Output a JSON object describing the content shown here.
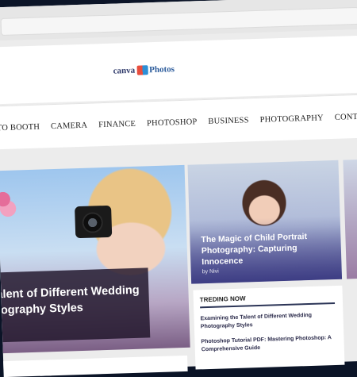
{
  "logo": {
    "part1": "canva",
    "part2": "Photos"
  },
  "nav": {
    "items": [
      "TO BOOTH",
      "CAMERA",
      "FINANCE",
      "PHOTOSHOP",
      "BUSINESS",
      "PHOTOGRAPHY",
      "CONTACT US"
    ]
  },
  "hero": {
    "caption_line1": "alent of Different Wedding",
    "caption_line2": "tography Styles"
  },
  "card2": {
    "title": "The Magic of Child Portrait Photography: Capturing Innocence",
    "author": "by Nivi"
  },
  "trending": {
    "heading": "TREDING NOW",
    "items": [
      "Examining the Talent of Different Wedding Photography Styles",
      "Photoshop Tutorial PDF: Mastering Photoshop: A Comprehensive Guide"
    ]
  }
}
